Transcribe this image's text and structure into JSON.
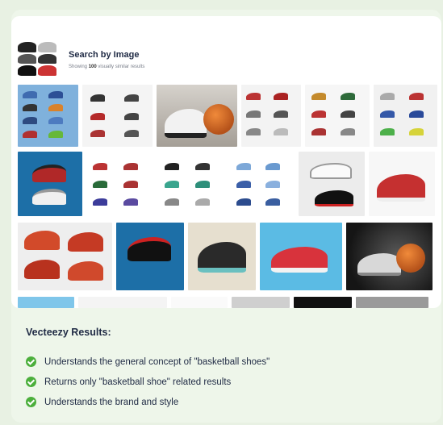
{
  "search": {
    "title": "Search by Image",
    "subtitle_prefix": "Showing ",
    "subtitle_count": "100",
    "subtitle_suffix": " visually similar results"
  },
  "results": {
    "title": "Vecteezy Results:",
    "items": [
      "Understands the general concept of \"basketball shoes\"",
      "Returns only \"basketball shoe\" related results",
      "Understands the brand and style"
    ]
  },
  "colors": {
    "check": "#4caf3c",
    "background": "#e8f1e3",
    "text": "#1f2a44"
  }
}
